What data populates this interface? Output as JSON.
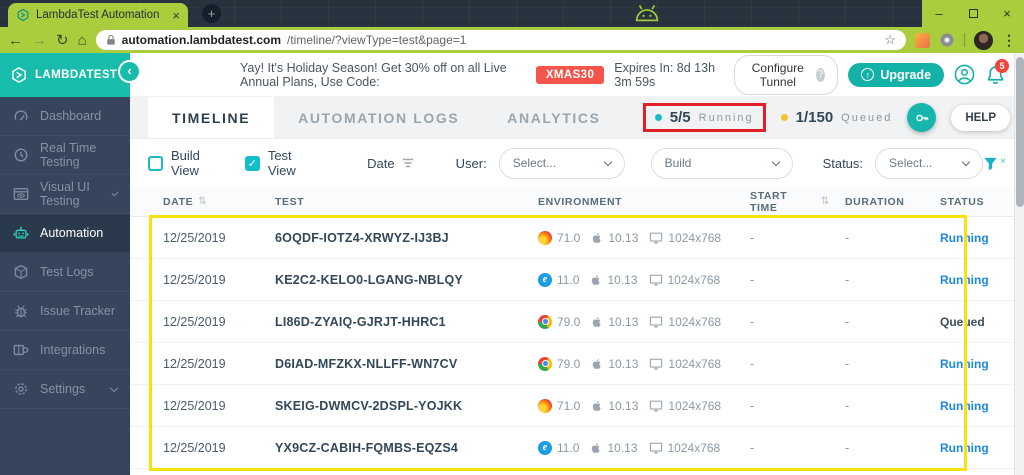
{
  "browser": {
    "tab_title": "LambdaTest Automation",
    "url_host": "automation.lambdatest.com",
    "url_path": "/timeline/?viewType=test&page=1"
  },
  "glyphs": {
    "back": "←",
    "forward": "→",
    "reload": "↻",
    "home": "⌂",
    "star": "☆",
    "menu": "⋮",
    "close": "×",
    "plus": "+",
    "sort": "⇅",
    "check": "✓",
    "question": "?",
    "up": "↑",
    "collapse": "‹"
  },
  "banner": {
    "message": "Yay! It's Holiday Season! Get 30% off on all Live Annual Plans, Use Code:",
    "promo_code": "XMAS30",
    "expires": "Expires In: 8d 13h 3m 59s",
    "configure_tunnel_label": "Configure Tunnel",
    "upgrade_label": "Upgrade",
    "notification_count": "5"
  },
  "sidebar": {
    "brand": "LAMBDATEST",
    "items": [
      {
        "label": "Dashboard",
        "active": false
      },
      {
        "label": "Real Time Testing",
        "active": false
      },
      {
        "label": "Visual UI Testing",
        "active": false,
        "has_submenu": true
      },
      {
        "label": "Automation",
        "active": true
      },
      {
        "label": "Test Logs",
        "active": false
      },
      {
        "label": "Issue Tracker",
        "active": false
      },
      {
        "label": "Integrations",
        "active": false
      },
      {
        "label": "Settings",
        "active": false,
        "has_submenu": true
      }
    ]
  },
  "tabs": [
    {
      "label": "TIMELINE",
      "active": true
    },
    {
      "label": "AUTOMATION LOGS",
      "active": false
    },
    {
      "label": "ANALYTICS",
      "active": false
    }
  ],
  "summary": {
    "running_count": "5/5",
    "running_label": "Running",
    "queued_count": "1/150",
    "queued_label": "Queued",
    "help_label": "HELP"
  },
  "filters": {
    "build_view_label": "Build View",
    "build_view_checked": false,
    "test_view_label": "Test View",
    "test_view_checked": true,
    "date_label": "Date",
    "user_label": "User:",
    "user_value": "Select...",
    "build_value": "Build",
    "status_label": "Status:",
    "status_value": "Select..."
  },
  "table": {
    "headers": [
      "DATE",
      "TEST",
      "ENVIRONMENT",
      "START TIME",
      "DURATION",
      "STATUS"
    ],
    "rows": [
      {
        "date": "12/25/2019",
        "test": "6OQDF-IOTZ4-XRWYZ-IJ3BJ",
        "browser": "firefox",
        "browser_version": "71.0",
        "os_version": "10.13",
        "resolution": "1024x768",
        "start_time": "-",
        "duration": "-",
        "status": "Running"
      },
      {
        "date": "12/25/2019",
        "test": "KE2C2-KELO0-LGANG-NBLQY",
        "browser": "ie",
        "browser_version": "11.0",
        "os_version": "10.13",
        "resolution": "1024x768",
        "start_time": "-",
        "duration": "-",
        "status": "Running"
      },
      {
        "date": "12/25/2019",
        "test": "LI86D-ZYAIQ-GJRJT-HHRC1",
        "browser": "chrome",
        "browser_version": "79.0",
        "os_version": "10.13",
        "resolution": "1024x768",
        "start_time": "-",
        "duration": "-",
        "status": "Queued"
      },
      {
        "date": "12/25/2019",
        "test": "D6IAD-MFZKX-NLLFF-WN7CV",
        "browser": "chrome",
        "browser_version": "79.0",
        "os_version": "10.13",
        "resolution": "1024x768",
        "start_time": "-",
        "duration": "-",
        "status": "Running"
      },
      {
        "date": "12/25/2019",
        "test": "SKEIG-DWMCV-2DSPL-YOJKK",
        "browser": "firefox",
        "browser_version": "71.0",
        "os_version": "10.13",
        "resolution": "1024x768",
        "start_time": "-",
        "duration": "-",
        "status": "Running"
      },
      {
        "date": "12/25/2019",
        "test": "YX9CZ-CABIH-FQMBS-EQZS4",
        "browser": "ie",
        "browser_version": "11.0",
        "os_version": "10.13",
        "resolution": "1024x768",
        "start_time": "-",
        "duration": "-",
        "status": "Running"
      }
    ]
  },
  "colors": {
    "accent_teal": "#17bcab",
    "running_blue": "#1c87e5",
    "queued_text": "#3c4d5e",
    "annotation_red": "#e11f26",
    "annotation_yellow": "#f4e30c",
    "promo_red": "#f4554b",
    "sidebar_navy": "#36455b",
    "browser_theme_green": "#a9cd3d",
    "queued_dot_yellow": "#f0c52c",
    "running_dot_teal": "#17bcc4"
  }
}
